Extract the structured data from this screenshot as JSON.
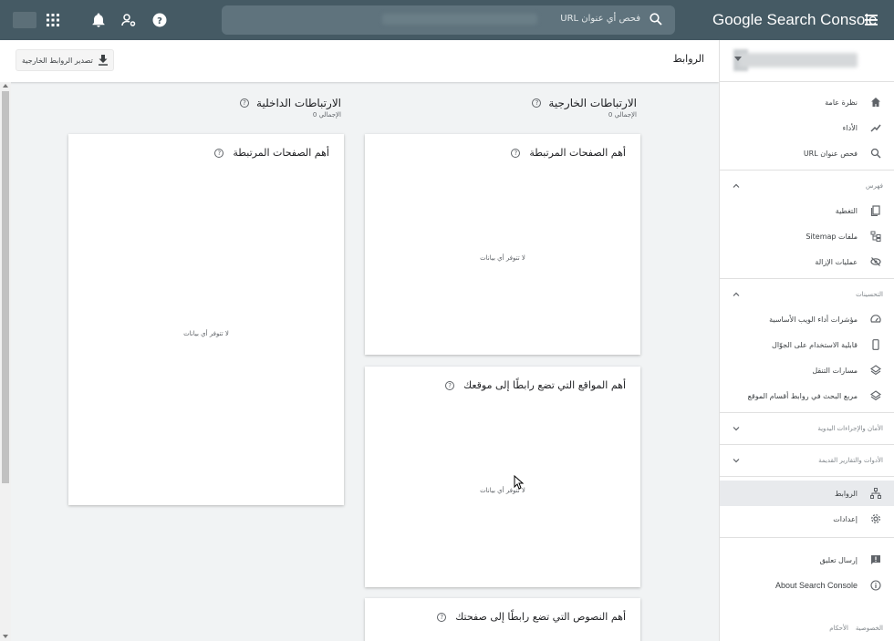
{
  "topbar": {
    "search_placeholder": "فحص أي عنوان URL",
    "brand": "Google Search Console",
    "icons": [
      "apps-grid-icon",
      "bell-icon",
      "user-settings-icon",
      "help-icon",
      "search-icon",
      "menu-icon"
    ]
  },
  "sidebar": {
    "items_top": [
      {
        "label": "نظرة عامة",
        "icon": "home-icon"
      },
      {
        "label": "الأداء",
        "icon": "trend-icon"
      },
      {
        "label": "فحص عنوان URL",
        "icon": "search-icon"
      }
    ],
    "index_section": {
      "label": "فهرس",
      "items": [
        {
          "label": "التغطية",
          "icon": "pages-icon"
        },
        {
          "label": "ملفات Sitemap",
          "icon": "sitemap-icon"
        },
        {
          "label": "عمليات الإزالة",
          "icon": "removal-icon"
        }
      ]
    },
    "enhancements_section": {
      "label": "التحسينات",
      "items": [
        {
          "label": "مؤشرات أداء الويب الأساسية",
          "icon": "gauge-icon"
        },
        {
          "label": "قابلية الاستخدام على الجوّال",
          "icon": "phone-icon"
        },
        {
          "label": "مسارات التنقل",
          "icon": "layers-icon"
        },
        {
          "label": "مربع البحث في روابط أقسام الموقع",
          "icon": "layers-icon"
        }
      ]
    },
    "security_section": {
      "label": "الأمان والإجراءات اليدوية"
    },
    "legacy_section": {
      "label": "الأدوات والتقارير القديمة"
    },
    "items_bottom": [
      {
        "label": "الروابط",
        "icon": "links-icon",
        "active": true
      },
      {
        "label": "إعدادات",
        "icon": "gear-icon"
      }
    ],
    "items_feedback": [
      {
        "label": "إرسال تعليق",
        "icon": "feedback-icon"
      },
      {
        "label": "About Search Console",
        "icon": "info-icon"
      }
    ],
    "footer": {
      "privacy": "الخصوصية",
      "terms": "الأحكام"
    }
  },
  "main": {
    "title": "الروابط",
    "export_label": "تصدير الروابط الخارجية",
    "external": {
      "title": "الارتباطات الخارجية",
      "total": "الإجمالي 0"
    },
    "internal": {
      "title": "الارتباطات الداخلية",
      "total": "الإجمالي 0"
    },
    "cards": {
      "ext_top_pages": {
        "title": "أهم الصفحات المرتبطة",
        "empty": "لا تتوفر أي بيانات"
      },
      "ext_top_sites": {
        "title": "أهم المواقع التي تضع رابطًا إلى موقعك",
        "empty": "لا تتوفر أي بيانات"
      },
      "ext_top_texts": {
        "title": "أهم النصوص التي تضع رابطًا إلى صفحتك"
      },
      "int_top_pages": {
        "title": "أهم الصفحات المرتبطة",
        "empty": "لا تتوفر أي بيانات"
      }
    }
  }
}
